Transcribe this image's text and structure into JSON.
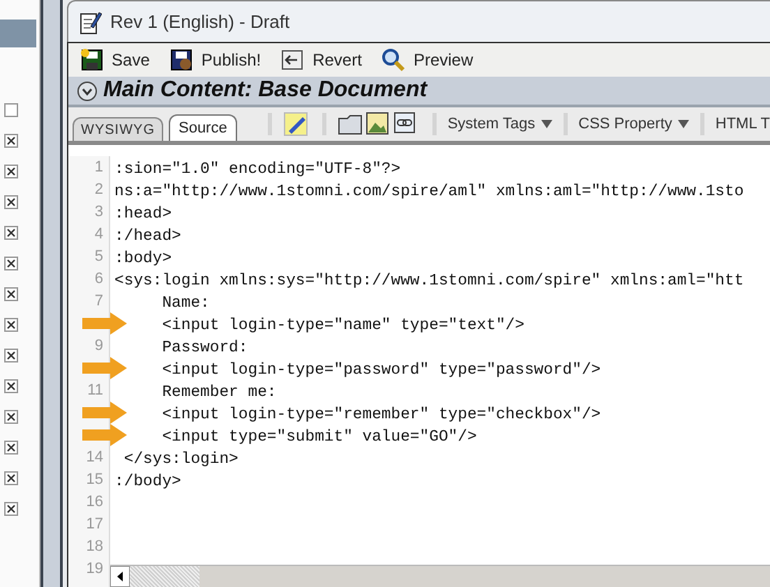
{
  "sidebar": {
    "checkboxes": [
      {
        "checked": false
      },
      {
        "checked": true
      },
      {
        "checked": true
      },
      {
        "checked": true
      },
      {
        "checked": true
      },
      {
        "checked": true
      },
      {
        "checked": true
      },
      {
        "checked": true
      },
      {
        "checked": true
      },
      {
        "checked": true
      },
      {
        "checked": true
      },
      {
        "checked": true
      },
      {
        "checked": true
      },
      {
        "checked": true
      }
    ]
  },
  "window": {
    "title": "Rev 1 (English) - Draft"
  },
  "toolbar": [
    {
      "kind": "save",
      "label": "Save"
    },
    {
      "kind": "publish",
      "label": "Publish!"
    },
    {
      "kind": "revert",
      "label": "Revert"
    },
    {
      "kind": "preview",
      "label": "Preview"
    }
  ],
  "section_title": "Main Content: Base Document",
  "tabs": [
    {
      "label": "WYSIWYG",
      "selected": false
    },
    {
      "label": "Source",
      "selected": true
    }
  ],
  "editor_tools": [
    {
      "kind": "eraser"
    },
    {
      "kind": "folder"
    },
    {
      "kind": "image"
    },
    {
      "kind": "link"
    },
    {
      "kind": "dropdown",
      "label": "System Tags"
    },
    {
      "kind": "dropdown",
      "label": "CSS Property"
    },
    {
      "kind": "cut",
      "label": "HTML T"
    }
  ],
  "code_lines": [
    {
      "number": "1",
      "text": ":sion=\"1.0\" encoding=\"UTF-8\"?>",
      "arrow": false
    },
    {
      "number": "2",
      "text": "ns:a=\"http://www.1stomni.com/spire/aml\" xmlns:aml=\"http://www.1sto",
      "arrow": false
    },
    {
      "number": "3",
      "text": ":head>",
      "arrow": false
    },
    {
      "number": "4",
      "text": ":/head>",
      "arrow": false
    },
    {
      "number": "5",
      "text": ":body>",
      "arrow": false
    },
    {
      "number": "6",
      "text": "<sys:login xmlns:sys=\"http://www.1stomni.com/spire\" xmlns:aml=\"htt",
      "arrow": false
    },
    {
      "number": "7",
      "text": "     Name:",
      "arrow": false
    },
    {
      "text": "     <input login-type=\"name\" type=\"text\"/>",
      "arrow": true
    },
    {
      "number": "9",
      "text": "     Password:",
      "arrow": false
    },
    {
      "text": "     <input login-type=\"password\" type=\"password\"/>",
      "arrow": true
    },
    {
      "number": "11",
      "text": "     Remember me:",
      "arrow": false
    },
    {
      "text": "     <input login-type=\"remember\" type=\"checkbox\"/>",
      "arrow": true
    },
    {
      "text": "     <input type=\"submit\" value=\"GO\"/>",
      "arrow": true
    },
    {
      "number": "14",
      "text": " </sys:login>",
      "arrow": false
    },
    {
      "number": "15",
      "text": ":/body>",
      "arrow": false
    },
    {
      "number": "16",
      "arrow": false
    },
    {
      "number": "17",
      "arrow": false
    },
    {
      "number": "18",
      "arrow": false
    },
    {
      "number": "19",
      "arrow": false
    }
  ]
}
